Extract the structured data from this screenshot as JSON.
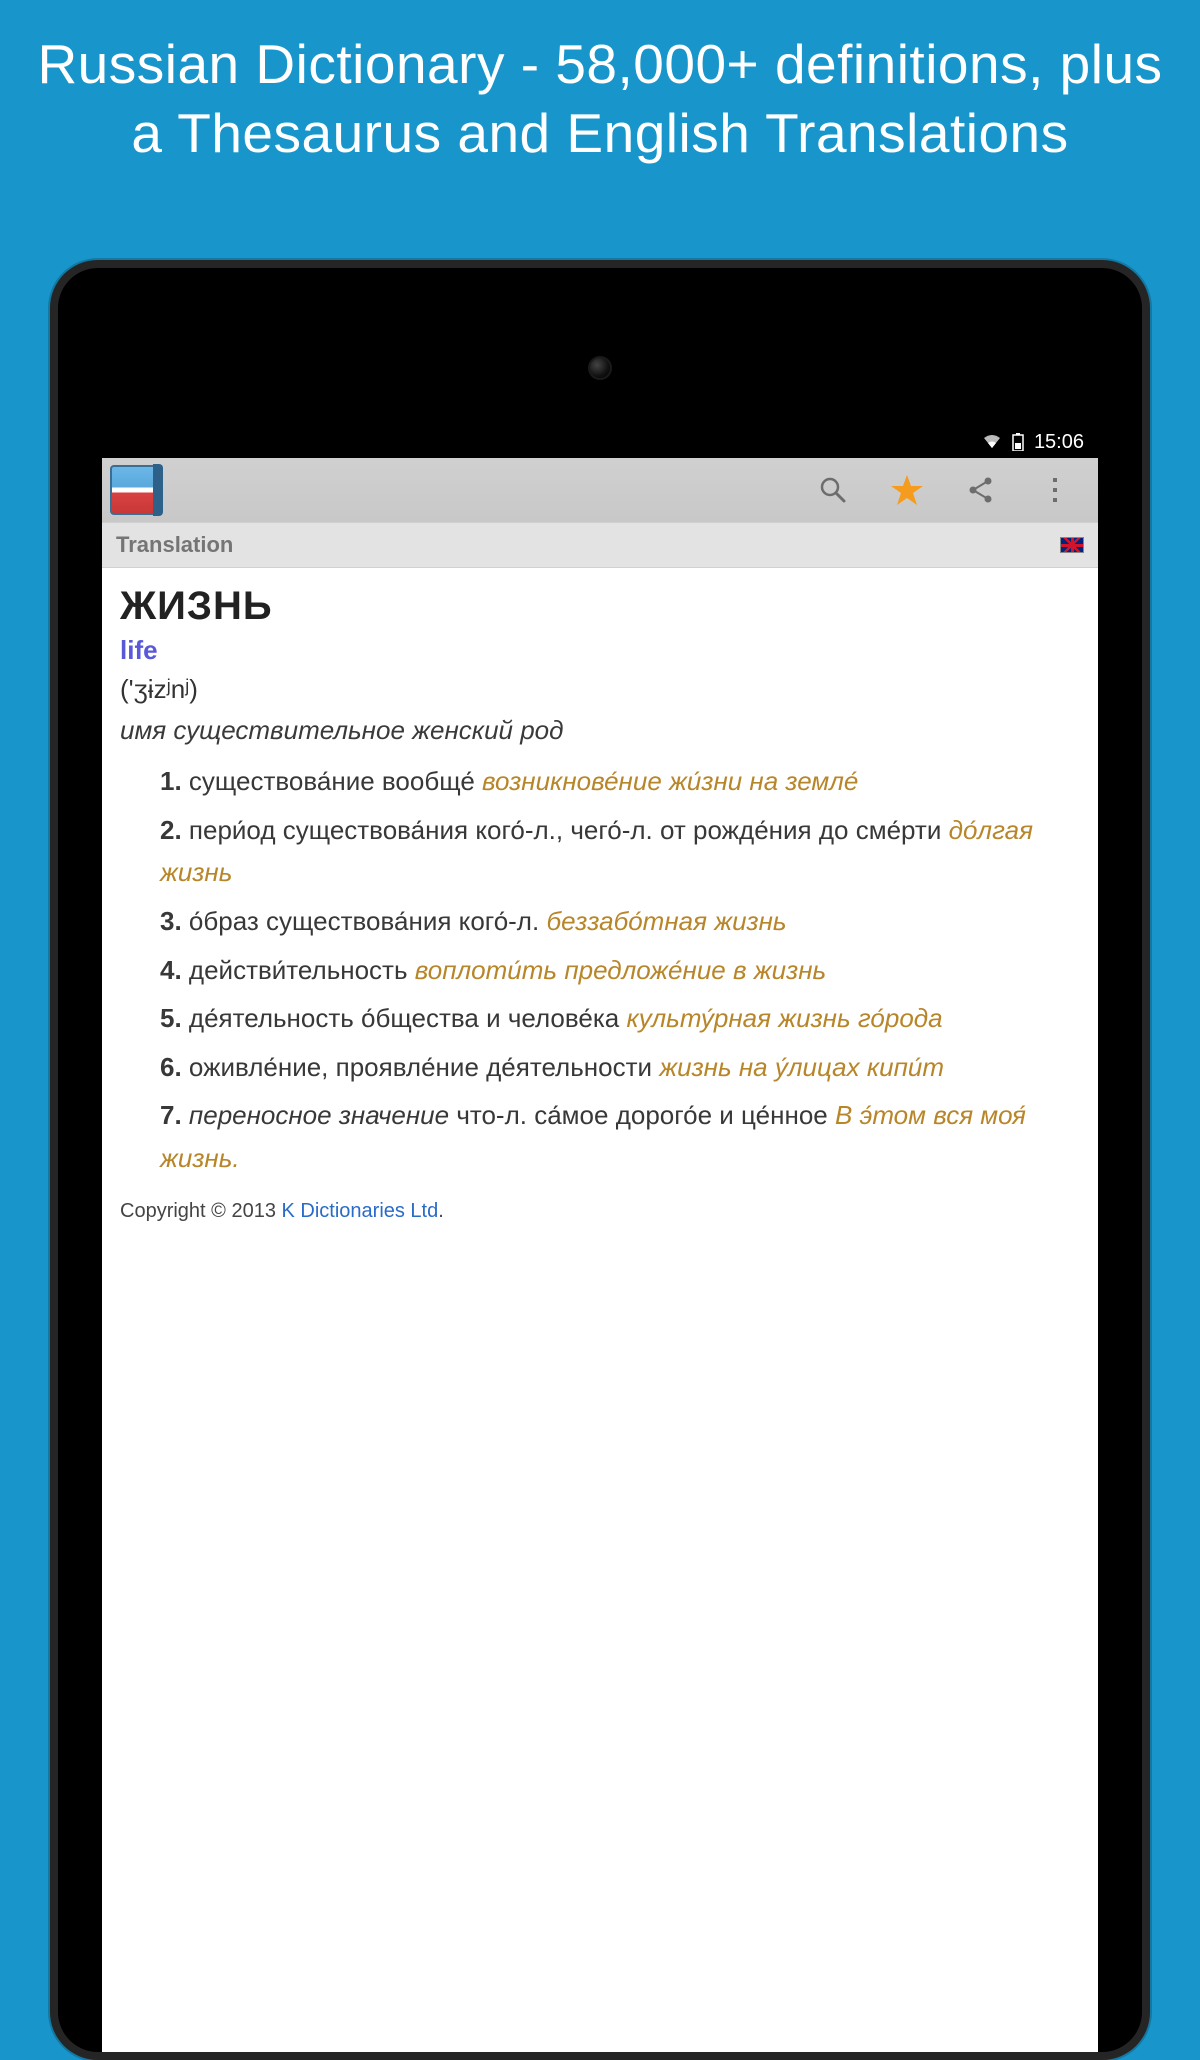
{
  "promo": {
    "title": "Russian Dictionary - 58,000+ definitions, plus a Thesaurus and English Translations"
  },
  "status_bar": {
    "time": "15:06"
  },
  "toolbar": {
    "section_label": "Translation"
  },
  "entry": {
    "headword": "ЖИЗНЬ",
    "translation": "life",
    "pronunciation": "('ʒɨzʲnʲ)",
    "pos": "имя существительное женский род",
    "definitions": [
      {
        "num": "1.",
        "text": "существова́ние вообще́ ",
        "example": "возникнове́ние жи́зни на земле́"
      },
      {
        "num": "2.",
        "text": "пери́од существова́ния кого́-л., чего́-л. от рожде́ния до сме́рти ",
        "example": "до́лгая жизнь"
      },
      {
        "num": "3.",
        "text": "о́браз существова́ния кого́-л. ",
        "example": "беззабо́тная жизнь"
      },
      {
        "num": "4.",
        "text": "действи́тельность ",
        "example": "воплоти́ть предложе́ние в жизнь"
      },
      {
        "num": "5.",
        "text": "де́ятельность о́бщества и челове́ка ",
        "example": "культу́рная жизнь го́рода"
      },
      {
        "num": "6.",
        "text": "оживле́ние, проявле́ние де́ятельности ",
        "example": "жизнь на у́лицах кипи́т"
      },
      {
        "num": "7.",
        "pre_italic": "переносное значение ",
        "text": "что-л. са́мое дорого́е и це́нное ",
        "example": "В э́том вся моя́ жизнь."
      }
    ]
  },
  "copyright": {
    "prefix": "Copyright © 2013 ",
    "link": "K Dictionaries Ltd",
    "suffix": "."
  }
}
